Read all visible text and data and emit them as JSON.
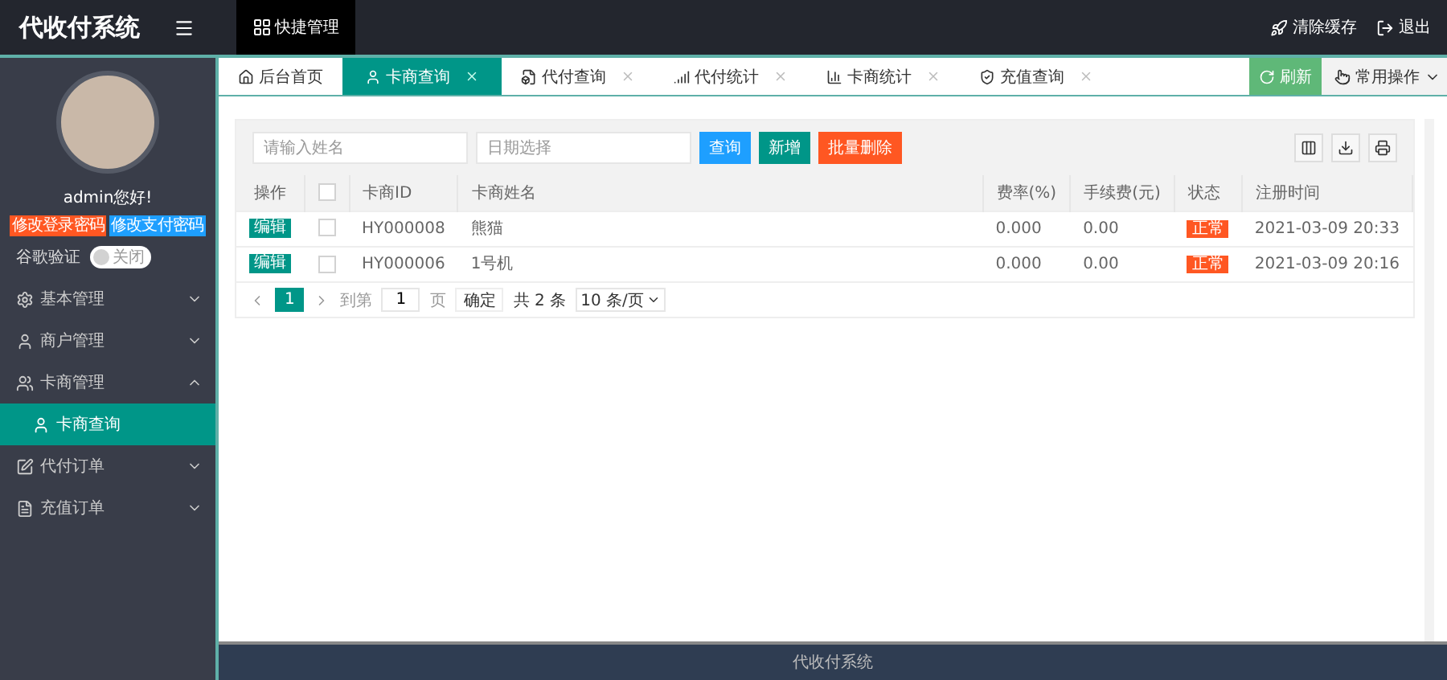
{
  "brand": "代收付系统",
  "quick_menu": "快捷管理",
  "header_actions": [
    {
      "label": "清除缓存",
      "kind": "rocket"
    },
    {
      "label": "退出",
      "kind": "logout"
    }
  ],
  "user": {
    "greeting": "admin您好!",
    "buttons": [
      {
        "label": "修改登录密码",
        "color": "#ff5722"
      },
      {
        "label": "修改支付密码",
        "color": "#1e9fff"
      }
    ],
    "google_auth": {
      "label": "谷歌验证",
      "on": false,
      "state_text": "关闭"
    }
  },
  "menu": [
    {
      "label": "基本管理",
      "kind": "gear",
      "expanded": false
    },
    {
      "label": "商户管理",
      "kind": "user",
      "expanded": false
    },
    {
      "label": "卡商管理",
      "kind": "users",
      "expanded": true,
      "children": [
        {
          "label": "卡商查询",
          "selected": true
        }
      ]
    },
    {
      "label": "代付订单",
      "kind": "edit",
      "expanded": false
    },
    {
      "label": "充值订单",
      "kind": "doc",
      "expanded": false
    }
  ],
  "tabs": [
    {
      "label": "后台首页",
      "kind": "home",
      "closable": false,
      "selected": false
    },
    {
      "label": "卡商查询",
      "kind": "user",
      "closable": true,
      "selected": true
    },
    {
      "label": "代付查询",
      "kind": "doc",
      "closable": true,
      "selected": false
    },
    {
      "label": "代付统计",
      "kind": "signal",
      "closable": true,
      "selected": false
    },
    {
      "label": "卡商统计",
      "kind": "bars",
      "closable": true,
      "selected": false
    },
    {
      "label": "充值查询",
      "kind": "shield",
      "closable": true,
      "selected": false
    }
  ],
  "refresh": "刷新",
  "common_ops": "常用操作",
  "search": {
    "name_placeholder": "请输入姓名",
    "date_placeholder": "日期选择",
    "buttons": [
      {
        "label": "查询",
        "color": "#1e9fff"
      },
      {
        "label": "新增",
        "color": "#009688"
      },
      {
        "label": "批量删除",
        "color": "#ff5722"
      }
    ]
  },
  "table": {
    "all_checked": false,
    "columns": [
      "操作",
      "卡商ID",
      "卡商姓名",
      "费率(%)",
      "手续费(元)",
      "状态",
      "注册时间"
    ],
    "rows": [
      {
        "action": "编辑",
        "checked": false,
        "id": "HY000008",
        "name": "熊猫",
        "rate": "0.000",
        "fee": "0.00",
        "status": "正常",
        "time": "2021-03-09 20:33"
      },
      {
        "action": "编辑",
        "checked": false,
        "id": "HY000006",
        "name": "1号机",
        "rate": "0.000",
        "fee": "0.00",
        "status": "正常",
        "time": "2021-03-09 20:16"
      }
    ]
  },
  "pagination": {
    "pages": [
      {
        "label": "1",
        "selected": true
      }
    ],
    "goto": "到第",
    "goto_value": "1",
    "page_unit": "页",
    "confirm": "确定",
    "total": "共 2 条",
    "page_size": "10 条/页"
  },
  "footer": "代收付系统"
}
